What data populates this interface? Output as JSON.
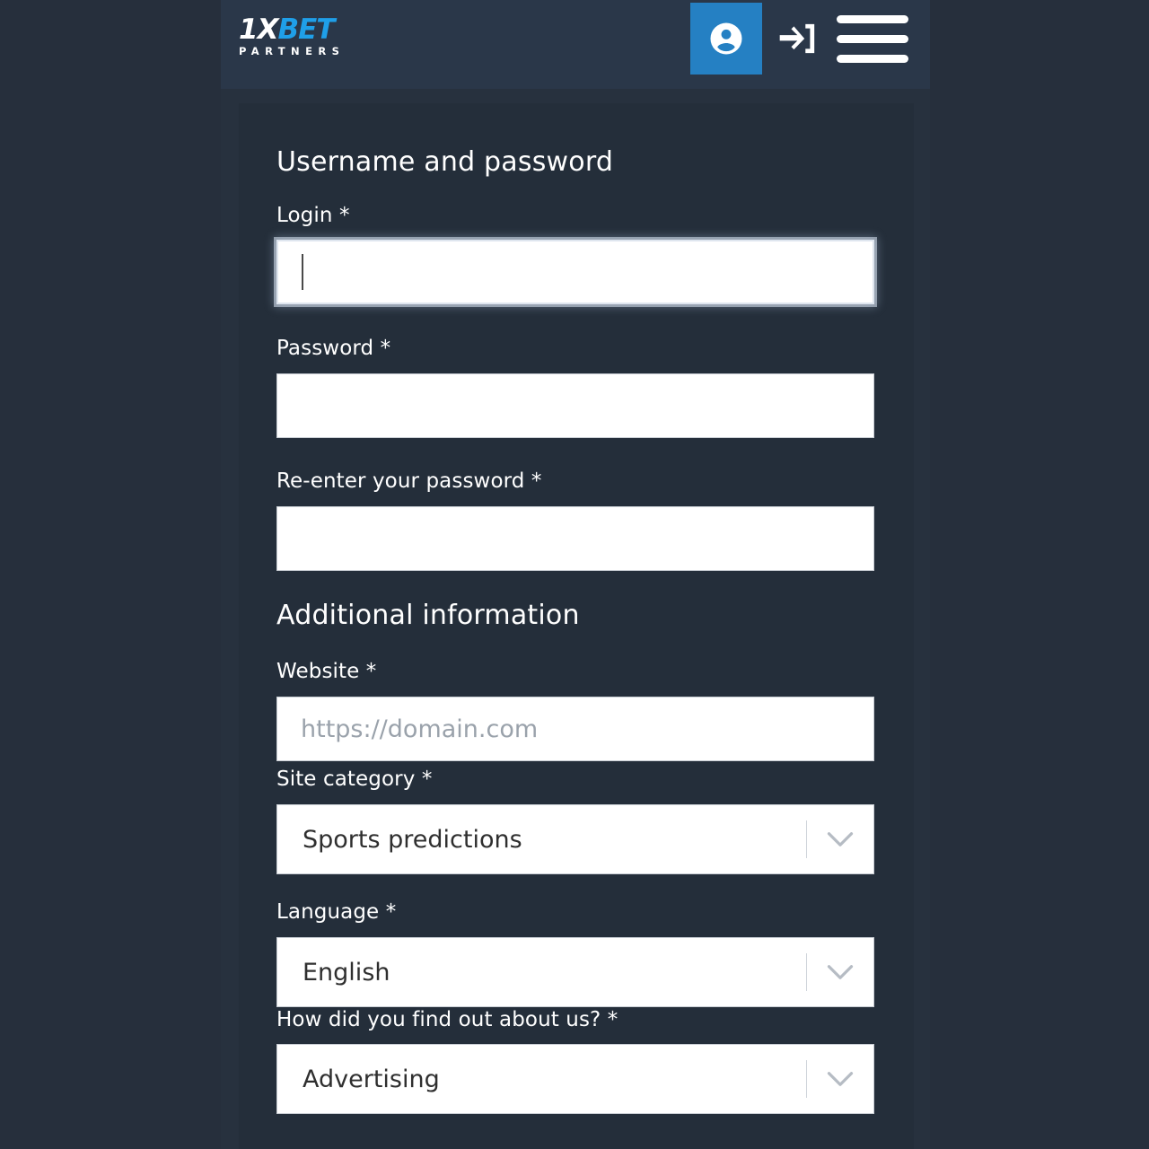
{
  "header": {
    "logo": {
      "part1": "1",
      "part2": "X",
      "part3": "BET",
      "subtitle": "PARTNERS"
    },
    "account_icon": "account-circle-icon",
    "signin_icon": "sign-in-icon",
    "menu_icon": "hamburger-menu-icon",
    "accent_color": "#2580c3",
    "background_color": "#2a3749"
  },
  "page": {
    "background_color": "#262f3c",
    "card_background_color": "#242e3a"
  },
  "form": {
    "section_1_title": "Username and password",
    "section_2_title": "Additional information",
    "fields": {
      "login": {
        "label": "Login *",
        "value": "",
        "placeholder": ""
      },
      "password": {
        "label": "Password *",
        "value": "",
        "placeholder": ""
      },
      "password_confirm": {
        "label": "Re-enter your password *",
        "value": "",
        "placeholder": ""
      },
      "website": {
        "label": "Website *",
        "value": "",
        "placeholder": "https://domain.com"
      },
      "site_category": {
        "label": "Site category *",
        "value": "Sports predictions",
        "chevron_icon": "chevron-down-icon"
      },
      "language": {
        "label": "Language *",
        "value": "English",
        "chevron_icon": "chevron-down-icon"
      },
      "referral_source": {
        "label": "How did you find out about us? *",
        "value": "Advertising",
        "chevron_icon": "chevron-down-icon"
      }
    }
  }
}
